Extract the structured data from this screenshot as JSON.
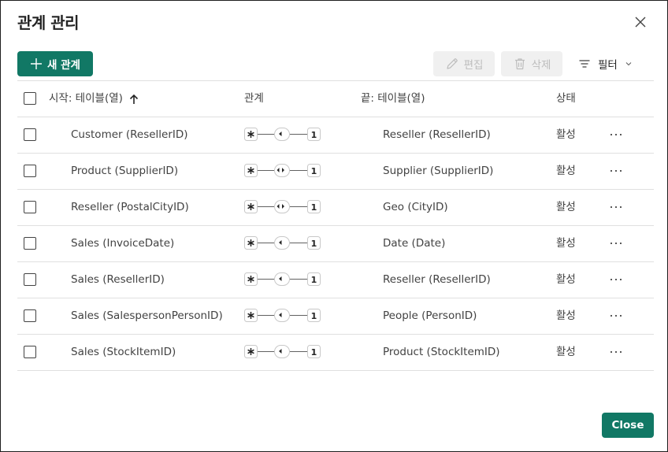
{
  "dialog": {
    "title": "관계 관리"
  },
  "toolbar": {
    "new_label": "새 관계",
    "edit_label": "편집",
    "delete_label": "삭제",
    "filter_label": "필터"
  },
  "table": {
    "headers": {
      "from": "시작: 테이블(열)",
      "relationship": "관계",
      "to": "끝: 테이블(열)",
      "state": "상태"
    },
    "rows": [
      {
        "from": "Customer (ResellerID)",
        "to": "Reseller (ResellerID)",
        "state": "활성",
        "direction": "single"
      },
      {
        "from": "Product (SupplierID)",
        "to": "Supplier (SupplierID)",
        "state": "활성",
        "direction": "both"
      },
      {
        "from": "Reseller (PostalCityID)",
        "to": "Geo (CityID)",
        "state": "활성",
        "direction": "both"
      },
      {
        "from": "Sales (InvoiceDate)",
        "to": "Date (Date)",
        "state": "활성",
        "direction": "single"
      },
      {
        "from": "Sales (ResellerID)",
        "to": "Reseller (ResellerID)",
        "state": "활성",
        "direction": "single"
      },
      {
        "from": "Sales (SalespersonPersonID)",
        "to": "People (PersonID)",
        "state": "활성",
        "direction": "single"
      },
      {
        "from": "Sales (StockItemID)",
        "to": "Product (StockItemID)",
        "state": "활성",
        "direction": "single"
      }
    ]
  },
  "footer": {
    "close_label": "Close"
  },
  "colors": {
    "accent": "#117865",
    "disabled_bg": "#f0f0f0",
    "disabled_text": "#bdbdbd"
  },
  "icons": {
    "close": "close-icon",
    "add": "plus-icon",
    "edit": "pencil-icon",
    "delete": "trash-icon",
    "filter": "filter-icon",
    "sort": "arrow-up-icon",
    "more": "more-horizontal-icon"
  }
}
